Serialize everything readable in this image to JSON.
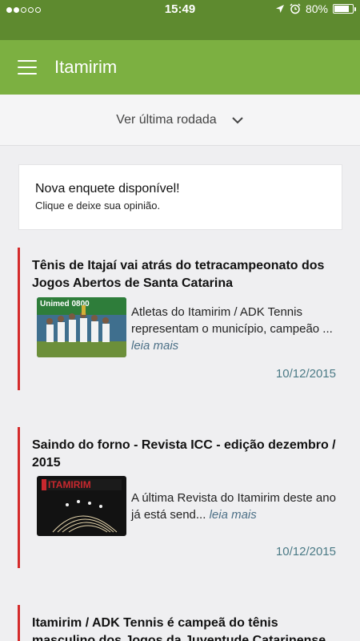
{
  "status": {
    "time": "15:49",
    "battery": "80%",
    "battery_level": 0.8
  },
  "app_bar": {
    "title": "Itamirim"
  },
  "round_selector": {
    "label": "Ver última rodada"
  },
  "poll": {
    "title": "Nova enquete disponível!",
    "subtitle": "Clique e deixe sua opinião."
  },
  "news": [
    {
      "title": "Tênis de Itajaí vai atrás do tetracampeonato dos Jogos Abertos de Santa Catarina",
      "excerpt": "Atletas do Itamirim / ADK Tennis representam o município, campeão ...",
      "more": "leia mais",
      "date": "10/12/2015",
      "thumb_text": "Unimed 0800"
    },
    {
      "title": "Saindo do forno - Revista ICC - edição dezembro / 2015",
      "excerpt": "A última Revista do Itamirim deste ano já está send...",
      "more": "leia mais",
      "date": "10/12/2015",
      "thumb_text": "ITAMIRIM"
    },
    {
      "title": "Itamirim / ADK Tennis é campeã do tênis masculino dos Jogos da Juventude Catarinense"
    }
  ]
}
